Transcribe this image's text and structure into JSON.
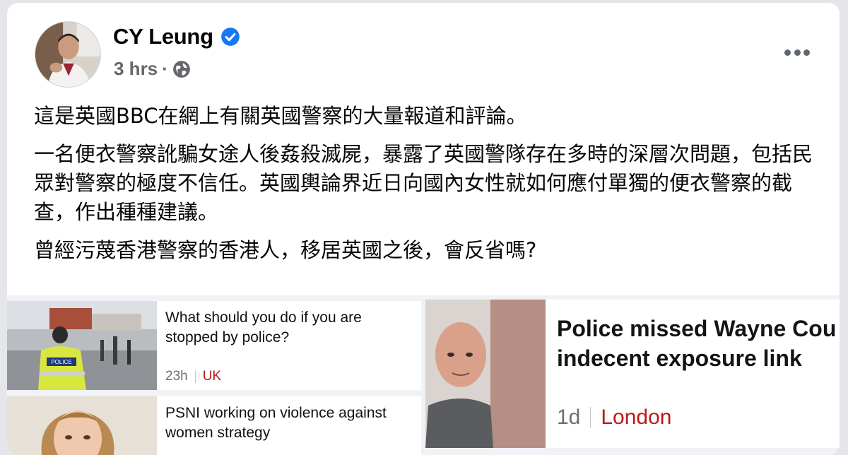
{
  "post": {
    "author": "CY Leung",
    "time": "3 hrs",
    "separator": "·",
    "paragraphs": [
      "這是英國BBC在網上有關英國警察的大量報道和評論。",
      "一名便衣警察訛騙女途人後姦殺滅屍，暴露了英國警隊存在多時的深層次問題，包括民眾對警察的極度不信任。英國輿論界近日向國內女性就如何應付單獨的便衣警察的截查，作出種種建議。",
      "曾經污蔑香港警察的香港人，移居英國之後，會反省嗎?"
    ]
  },
  "previews": {
    "left": [
      {
        "title": "What should you do if you are stopped by police?",
        "age": "23h",
        "region": "UK",
        "thumb_text": "POLICE"
      },
      {
        "title": "PSNI working on violence against women strategy",
        "age": "",
        "region": ""
      }
    ],
    "right": {
      "title_line1": "Police missed Wayne Cou",
      "title_line2": "indecent exposure link",
      "age": "1d",
      "region": "London"
    }
  },
  "colors": {
    "verified_badge": "#1877f2",
    "region_red": "#bb1919",
    "meta_gray": "#65676b",
    "background": "#e4e6ea"
  },
  "icons": [
    "verified-badge-icon",
    "globe-icon",
    "more-options-icon"
  ]
}
